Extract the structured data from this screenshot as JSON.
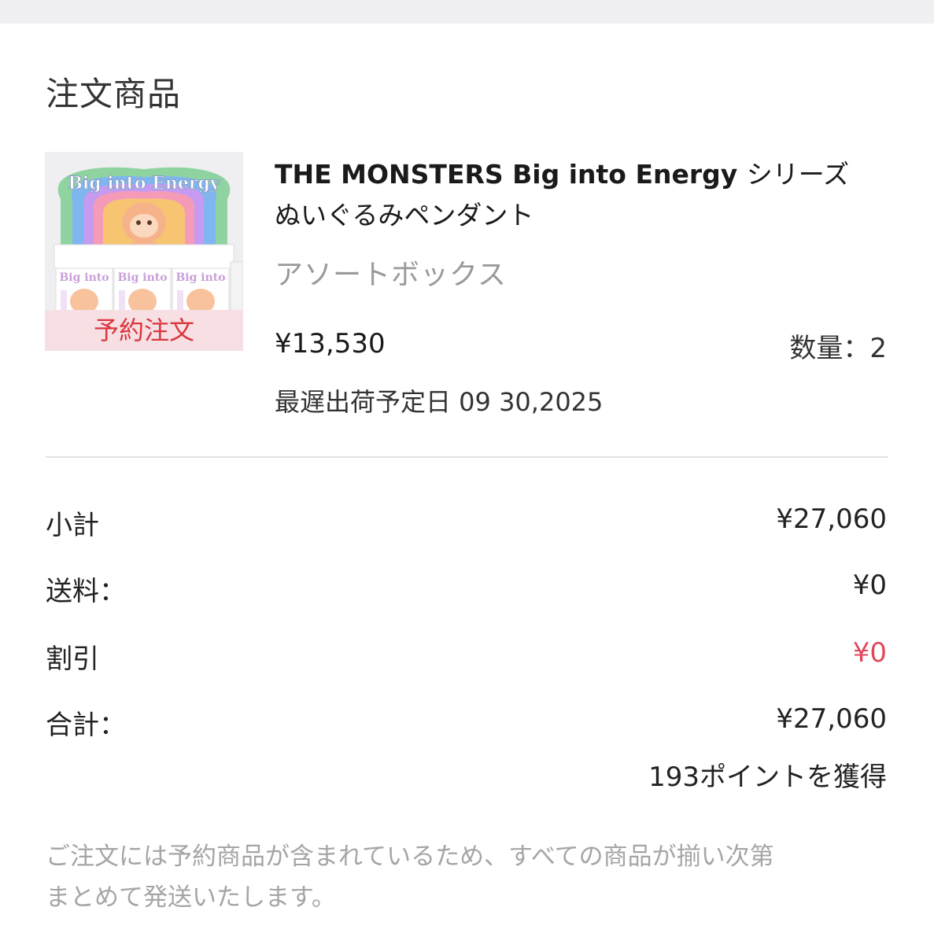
{
  "section": {
    "title": "注文商品"
  },
  "product": {
    "badge": "予約注文",
    "name_en": "THE MONSTERS Big into Energy",
    "name_jp_1": "シリーズ",
    "name_jp_2": "ぬいぐるみペンダント",
    "variant": "アソートボックス",
    "price": "¥13,530",
    "quantity": "数量：2",
    "ship_date": "最遅出荷予定日 09 30,2025",
    "image_text": "Big into Energy",
    "box_text": "Big into"
  },
  "summary": {
    "subtotal_label": "小計",
    "subtotal_value": "¥27,060",
    "shipping_label": "送料：",
    "shipping_value": "¥0",
    "discount_label": "割引",
    "discount_value": "¥0",
    "total_label": "合計：",
    "total_value": "¥27,060",
    "points": "193ポイントを獲得"
  },
  "notice": {
    "line1": "ご注文には予約商品が含まれているため、すべての商品が揃い次第",
    "line2": "まとめて発送いたします。"
  },
  "colors": {
    "accent_red": "#e0485a",
    "badge_bg": "#f7dfe3",
    "muted_text": "#a5a5a5"
  }
}
